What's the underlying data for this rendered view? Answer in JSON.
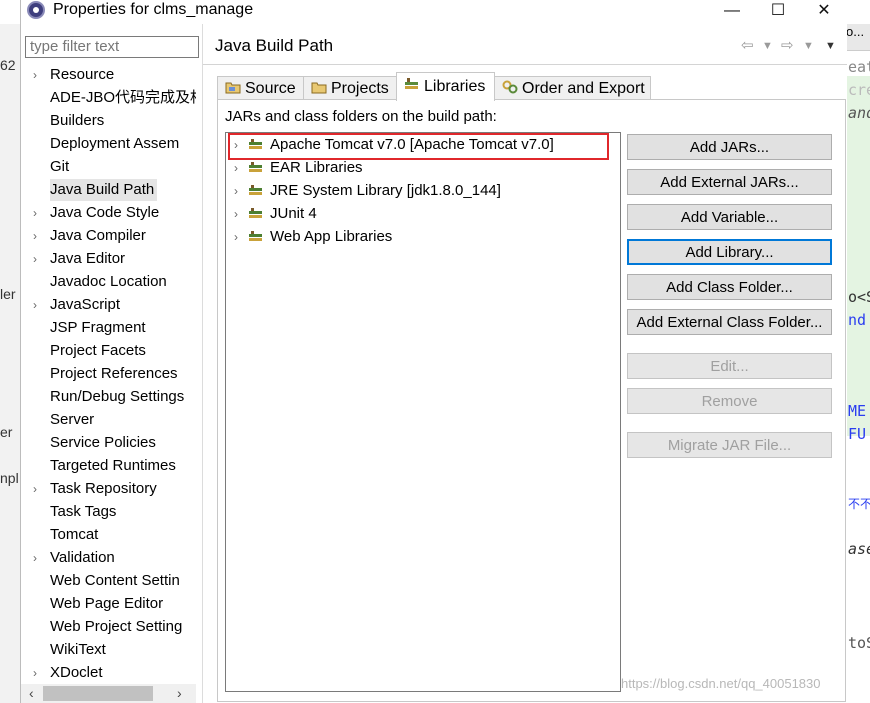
{
  "window": {
    "title": "Properties for clms_manage",
    "minimize": "—",
    "maximize": "☐",
    "close": "✕"
  },
  "filter": {
    "placeholder": "type filter text"
  },
  "tree": {
    "items": [
      {
        "label": "Resource",
        "expandable": true
      },
      {
        "label": "ADE-JBO代码完成及相",
        "expandable": false
      },
      {
        "label": "Builders",
        "expandable": false
      },
      {
        "label": "Deployment Assem",
        "expandable": false
      },
      {
        "label": "Git",
        "expandable": false
      },
      {
        "label": "Java Build Path",
        "expandable": false,
        "selected": true
      },
      {
        "label": "Java Code Style",
        "expandable": true
      },
      {
        "label": "Java Compiler",
        "expandable": true
      },
      {
        "label": "Java Editor",
        "expandable": true
      },
      {
        "label": "Javadoc Location",
        "expandable": false
      },
      {
        "label": "JavaScript",
        "expandable": true
      },
      {
        "label": "JSP Fragment",
        "expandable": false
      },
      {
        "label": "Project Facets",
        "expandable": false
      },
      {
        "label": "Project References",
        "expandable": false
      },
      {
        "label": "Run/Debug Settings",
        "expandable": false
      },
      {
        "label": "Server",
        "expandable": false
      },
      {
        "label": "Service Policies",
        "expandable": false
      },
      {
        "label": "Targeted Runtimes",
        "expandable": false
      },
      {
        "label": "Task Repository",
        "expandable": true
      },
      {
        "label": "Task Tags",
        "expandable": false
      },
      {
        "label": "Tomcat",
        "expandable": false
      },
      {
        "label": "Validation",
        "expandable": true
      },
      {
        "label": "Web Content Settin",
        "expandable": false
      },
      {
        "label": "Web Page Editor",
        "expandable": false
      },
      {
        "label": "Web Project Setting",
        "expandable": false
      },
      {
        "label": "WikiText",
        "expandable": false
      },
      {
        "label": "XDoclet",
        "expandable": true
      }
    ]
  },
  "panel": {
    "title": "Java Build Path",
    "tabs": [
      {
        "label": "Source",
        "active": false
      },
      {
        "label": "Projects",
        "active": false
      },
      {
        "label": "Libraries",
        "active": true
      },
      {
        "label": "Order and Export",
        "active": false
      }
    ],
    "jars_label": "JARs and class folders on the build path:",
    "libraries": [
      {
        "label": "Apache Tomcat v7.0 [Apache Tomcat v7.0]",
        "highlighted": true
      },
      {
        "label": "EAR Libraries"
      },
      {
        "label": "JRE System Library [jdk1.8.0_144]"
      },
      {
        "label": "JUnit 4"
      },
      {
        "label": "Web App Libraries"
      }
    ],
    "buttons": {
      "add_jars": "Add JARs...",
      "add_external_jars": "Add External JARs...",
      "add_variable": "Add Variable...",
      "add_library": "Add Library...",
      "add_class_folder": "Add Class Folder...",
      "add_external_class_folder": "Add External Class Folder...",
      "edit": "Edit...",
      "remove": "Remove",
      "migrate_jar": "Migrate JAR File..."
    }
  },
  "background": {
    "left_fragments": [
      "62",
      "ler",
      "er",
      "npl"
    ],
    "right_fragments": [
      "eat",
      "cre",
      "and",
      "o<S",
      "nd",
      "ME",
      "FU",
      "不不",
      "ase",
      "toS"
    ],
    "right_tab": "o..."
  },
  "watermark": "https://blog.csdn.net/qq_40051830",
  "colors": {
    "highlight_border": "#e0272b",
    "focus": "#0078d7",
    "selected_item": "#e5e5e5"
  }
}
